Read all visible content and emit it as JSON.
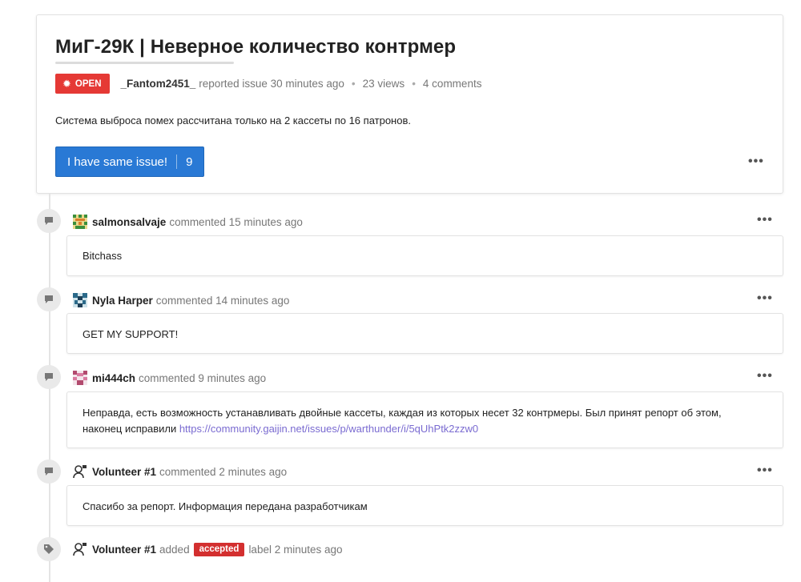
{
  "issue": {
    "title": "МиГ-29К | Неверное количество контрмер",
    "status": "OPEN",
    "author": "_Fantom2451_",
    "reported_text": "reported issue 30 minutes ago",
    "views": "23 views",
    "comments_count": "4 comments",
    "description": "Система выброса помех рассчитана только на 2 кассеты по 16 патронов.",
    "same_issue_label": "I have same issue!",
    "same_issue_count": "9",
    "more_label": "•••"
  },
  "comments": [
    {
      "author": "salmonsalvaje",
      "meta": "commented 15 minutes ago",
      "body": "Bitchass"
    },
    {
      "author": "Nyla Harper",
      "meta": "commented 14 minutes ago",
      "body": "GET MY SUPPORT!"
    },
    {
      "author": "mi444ch",
      "meta": "commented 9 minutes ago",
      "body_line1": "Неправда, есть возможность устанавливать двойные кассеты, каждая из которых несет 32 контрмеры. Был принят репорт об этом,",
      "body_line2_prefix": "наконец исправили ",
      "link": "https://community.gaijin.net/issues/p/warthunder/i/5qUhPtk2zzw0"
    },
    {
      "author": "Volunteer #1",
      "meta": "commented 2 minutes ago",
      "body": "Спасибо за репорт. Информация передана разработчикам"
    }
  ],
  "label_event": {
    "author": "Volunteer #1",
    "action": "added",
    "label": "accepted",
    "suffix": "label 2 minutes ago"
  },
  "colors": {
    "open_badge": "#e53935",
    "primary_button": "#2979d5",
    "accepted_label": "#d32f2f",
    "link": "#7a6bd1"
  }
}
